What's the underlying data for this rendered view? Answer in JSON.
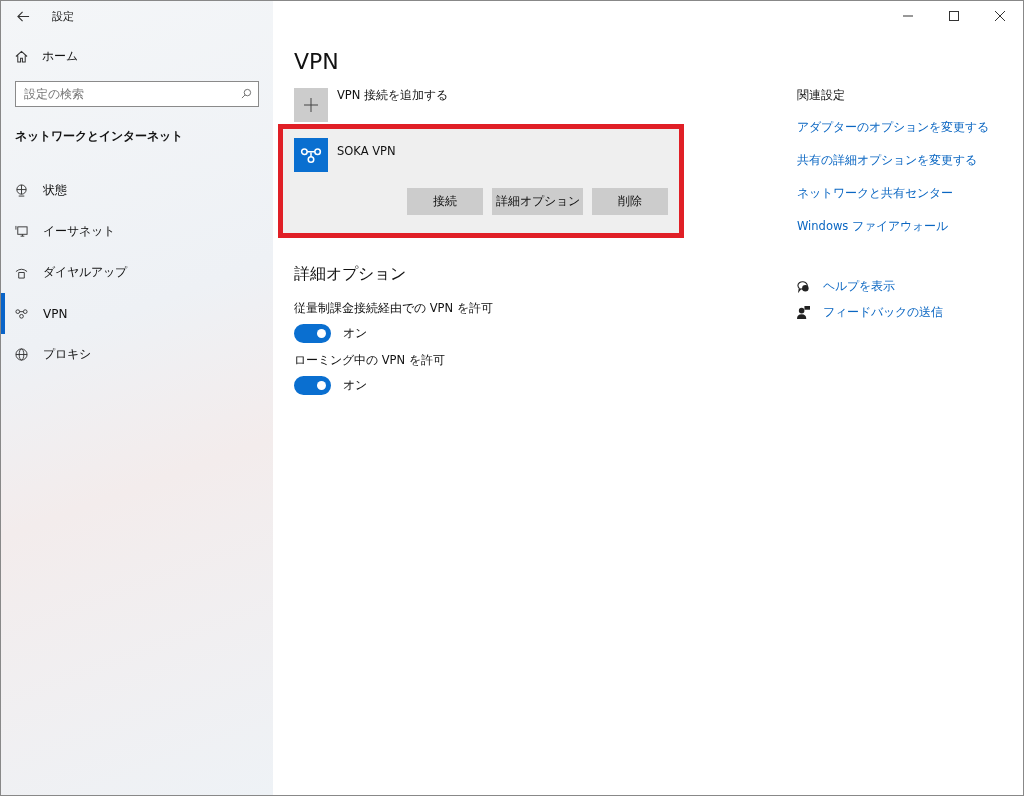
{
  "window": {
    "title": "設定"
  },
  "sidebar": {
    "home": "ホーム",
    "search": {
      "placeholder": "設定の検索"
    },
    "section": "ネットワークとインターネット",
    "items": [
      {
        "label": "状態",
        "kind": "status",
        "selected": false
      },
      {
        "label": "イーサネット",
        "kind": "ethernet",
        "selected": false
      },
      {
        "label": "ダイヤルアップ",
        "kind": "dialup",
        "selected": false
      },
      {
        "label": "VPN",
        "kind": "vpn",
        "selected": true
      },
      {
        "label": "プロキシ",
        "kind": "proxy",
        "selected": false
      }
    ]
  },
  "main": {
    "title": "VPN",
    "add_label": "VPN 接続を追加する",
    "connection": {
      "name": "SOKA VPN",
      "highlighted": true,
      "buttons": [
        "接続",
        "詳細オプション",
        "削除"
      ]
    },
    "advanced_title": "詳細オプション",
    "options": [
      {
        "label": "従量制課金接続経由での VPN を許可",
        "on": true,
        "state": "オン"
      },
      {
        "label": "ローミング中の VPN を許可",
        "on": true,
        "state": "オン"
      }
    ]
  },
  "related": {
    "title": "関連設定",
    "links": [
      "アダプターのオプションを変更する",
      "共有の詳細オプションを変更する",
      "ネットワークと共有センター",
      "Windows ファイアウォール"
    ],
    "help": [
      {
        "label": "ヘルプを表示",
        "kind": "help"
      },
      {
        "label": "フィードバックの送信",
        "kind": "feedback"
      }
    ]
  }
}
